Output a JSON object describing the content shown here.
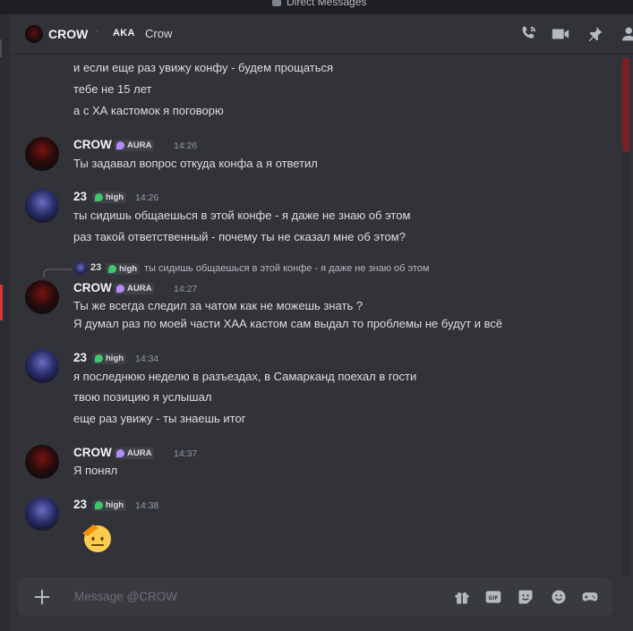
{
  "window": {
    "title": "Direct Messages"
  },
  "header": {
    "name": "CROW",
    "aka_label": "AKA",
    "aka_name": "Crow"
  },
  "messages": {
    "m0": {
      "lines": [
        "и если еще раз увижу конфу - будем прощаться",
        "тебе не 15 лет",
        "а с ХА кастомок я поговорю"
      ]
    },
    "m1": {
      "author": "CROW",
      "tag": "AURA",
      "time": "14:26",
      "lines": [
        "Ты задавал вопрос откуда конфа а я ответил"
      ]
    },
    "m2": {
      "author": "23",
      "tag": "high",
      "time": "14:26",
      "lines": [
        "ты сидишь общаешься в этой конфе - я даже не знаю об этом",
        "раз такой ответственный - почему ты не сказал мне об этом?"
      ]
    },
    "m3": {
      "reply": {
        "author": "23",
        "tag": "high",
        "text": "ты сидишь общаешься в этой конфе - я даже не знаю об этом"
      },
      "author": "CROW",
      "tag": "AURA",
      "time": "14:27",
      "lines": [
        "Ты же всегда следил за чатом как  не можешь знать ?",
        "Я думал раз по моей части ХАА кастом сам выдал то проблемы не будут и всё"
      ]
    },
    "m4": {
      "author": "23",
      "tag": "high",
      "time": "14:34",
      "lines": [
        "я последнюю неделю в разъездах, в Самарканд поехал в гости",
        "твою позицию я услышал",
        "еще раз увижу - ты знаешь итог"
      ]
    },
    "m5": {
      "author": "CROW",
      "tag": "AURA",
      "time": "14:37",
      "lines": [
        "Я понял"
      ]
    },
    "m6": {
      "author": "23",
      "tag": "high",
      "time": "14:38",
      "emoji": "saluting-face"
    }
  },
  "composer": {
    "placeholder": "Message @CROW"
  },
  "colors": {
    "accent_red": "#da373c",
    "aura_tag": "#b28cff",
    "high_tag": "#3cc86b"
  }
}
